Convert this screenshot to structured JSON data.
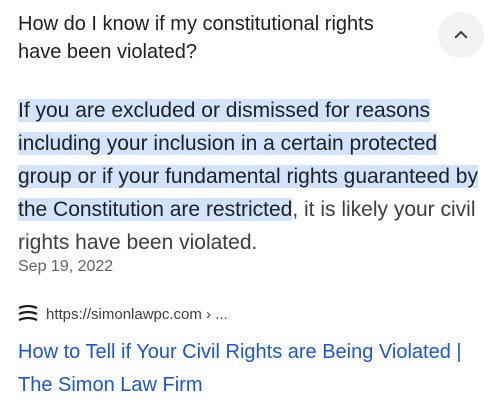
{
  "question": "How do I know if my constitutional rights have been violated?",
  "answer": {
    "highlighted": "If you are excluded or dismissed for reasons including your inclusion in a certain protected group or if your fundamental rights guaranteed by the Constitution are restricted",
    "rest": ", it is likely your civil rights have been violated."
  },
  "date": "Sep 19, 2022",
  "source": {
    "url": "https://simonlawpc.com › ...",
    "icon": "simon-law-favicon"
  },
  "result_title": "How to Tell if Your Civil Rights are Being Violated | The Simon Law Firm",
  "colors": {
    "highlight": "#d2e3fc",
    "link": "#1a56db",
    "muted": "#5f6368"
  }
}
